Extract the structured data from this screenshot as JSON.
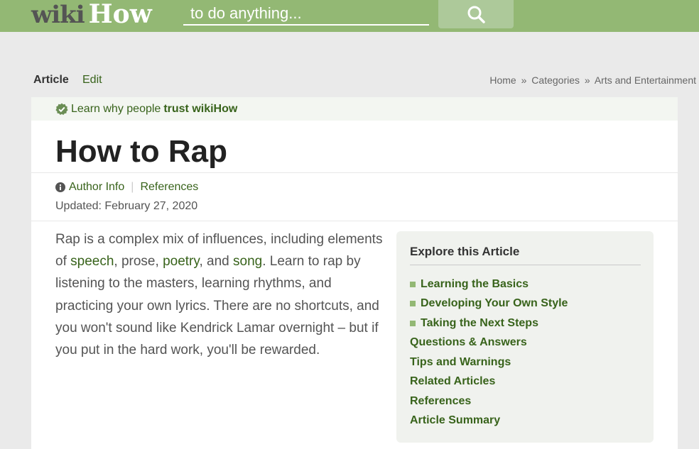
{
  "header": {
    "logo_wiki": "wiki",
    "logo_how": "How",
    "search_placeholder": "to do anything...",
    "search_icon": "search-icon"
  },
  "tabs": {
    "article": "Article",
    "edit": "Edit"
  },
  "breadcrumb": {
    "items": [
      "Home",
      "Categories",
      "Arts and Entertainment"
    ],
    "separator": "»"
  },
  "trust": {
    "prefix": "Learn why people",
    "bold": "trust wikiHow",
    "icon": "verified-check-icon"
  },
  "article": {
    "title": "How to Rap",
    "author_info": "Author Info",
    "references": "References",
    "updated": "Updated: February 27, 2020",
    "intro": {
      "p1": "Rap is a complex mix of influences, including elements of ",
      "link_speech": "speech",
      "p2": ", prose, ",
      "link_poetry": "poetry",
      "p3": ", and ",
      "link_song": "song",
      "p4": ". Learn to rap by listening to the masters, learning rhythms, and practicing your own lyrics. There are no shortcuts, and you won't sound like Kendrick Lamar overnight – but if you put in the hard work, you'll be rewarded."
    }
  },
  "toc": {
    "title": "Explore this Article",
    "items": [
      {
        "label": "Learning the Basics",
        "bullet": true
      },
      {
        "label": "Developing Your Own Style",
        "bullet": true
      },
      {
        "label": "Taking the Next Steps",
        "bullet": true
      },
      {
        "label": "Questions & Answers",
        "bullet": false
      },
      {
        "label": "Tips and Warnings",
        "bullet": false
      },
      {
        "label": "Related Articles",
        "bullet": false
      },
      {
        "label": "References",
        "bullet": false
      },
      {
        "label": "Article Summary",
        "bullet": false
      }
    ]
  },
  "colors": {
    "header_bg": "#93b874",
    "link_green": "#38631b",
    "page_bg": "#eaeaea",
    "toc_bg": "#f0f2ee"
  }
}
